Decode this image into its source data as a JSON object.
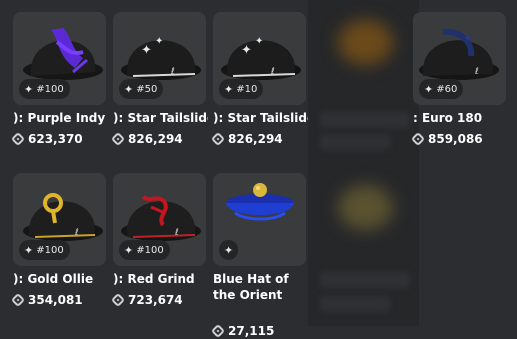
{
  "items": [
    {
      "name": "): Purple Indy",
      "badge": "#100",
      "price": "623,370"
    },
    {
      "name": "): Star Tailslide",
      "badge": "#50",
      "price": "826,294"
    },
    {
      "name": "): Star Tailslide",
      "badge": "#10",
      "price": "826,294"
    },
    {
      "name": ": Euro 180",
      "badge": "#60",
      "price": "859,086"
    },
    {
      "name": "): Gold Ollie",
      "badge": "#100",
      "price": "354,081"
    },
    {
      "name": "): Red Grind",
      "badge": "#100",
      "price": "723,674"
    },
    {
      "name": "Blue Hat of the Orient",
      "badge": "",
      "price": "27,115"
    }
  ],
  "icons": {
    "badge": "sparkle-icon",
    "price": "robux-icon"
  },
  "colors": {
    "background": "#2b2d31",
    "tile": "#393b3d",
    "text": "#ffffff"
  }
}
